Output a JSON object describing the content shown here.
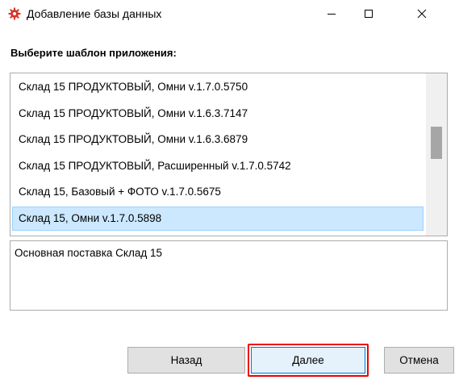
{
  "window": {
    "title": "Добавление базы данных",
    "icon": "red-gear-icon",
    "controls": [
      "minimize-icon",
      "maximize-icon",
      "close-icon"
    ]
  },
  "prompt": "Выберите шаблон приложения:",
  "templates": [
    "Склад 15 ПРОДУКТОВЫЙ, Омни v.1.7.0.5750",
    "Склад 15 ПРОДУКТОВЫЙ, Омни v.1.6.3.7147",
    "Склад 15 ПРОДУКТОВЫЙ, Омни v.1.6.3.6879",
    "Склад 15 ПРОДУКТОВЫЙ, Расширенный v.1.7.0.5742",
    "Склад 15, Базовый + ФОТО v.1.7.0.5675",
    "Склад 15, Омни v.1.7.0.5898"
  ],
  "selected_index": 5,
  "scroll": {
    "thumb_start": 0.33,
    "thumb_fraction": 0.2
  },
  "description": "Основная поставка Склад 15",
  "buttons": {
    "back": "Назад",
    "next": "Далее",
    "cancel": "Отмена"
  },
  "colors": {
    "selection": "#cce8ff",
    "highlight": "#ee0000",
    "icon": "#d9342b"
  }
}
